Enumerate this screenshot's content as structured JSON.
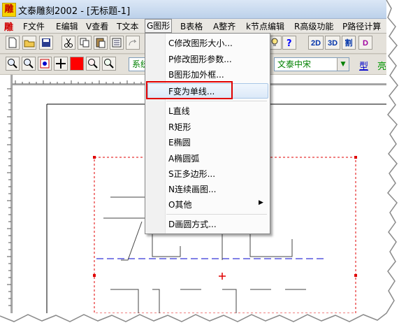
{
  "app": {
    "logo_char": "雕",
    "title": "文泰雕刻2002 - [无标题-1]"
  },
  "menubar": {
    "logo_char": "雕",
    "items": [
      "F文件",
      "E编辑",
      "V查看",
      "T文本",
      "G图形",
      "B表格",
      "A整齐",
      "k节点编辑",
      "R高级功能",
      "P路径计算"
    ],
    "active_index": 4
  },
  "toolbar1": {
    "icons": [
      "new-file",
      "open-folder",
      "save",
      "cut",
      "copy",
      "paste",
      "page-setup",
      "redo"
    ],
    "right_icons": [
      "bulb",
      "help"
    ],
    "buttons": [
      "2D",
      "3D",
      "割",
      "D"
    ]
  },
  "toolbar2": {
    "icons": [
      "zoom-in",
      "zoom-out",
      "zoom-fit",
      "pan",
      "color-red",
      "zoom-area",
      "zoom-page"
    ],
    "combo_left": "系统",
    "font_combo": "文泰中宋",
    "type_link": "型",
    "extra_label": "亮"
  },
  "dropdown": {
    "items": [
      {
        "label": "C修改图形大小..."
      },
      {
        "label": "P修改图形参数..."
      },
      {
        "label": "B图形加外框..."
      },
      {
        "label": "F变为单线..."
      },
      {
        "label": "L直线"
      },
      {
        "label": "R矩形"
      },
      {
        "label": "E椭圆"
      },
      {
        "label": "A椭圆弧"
      },
      {
        "label": "S正多边形..."
      },
      {
        "label": "N连续画图..."
      },
      {
        "label": "O其他",
        "submenu": true
      },
      {
        "label": "D画圆方式..."
      }
    ],
    "highlighted_index": 3
  },
  "canvas_glyphs": "无患",
  "colors": {
    "accent_red": "#e00000",
    "guide_blue": "#0000cc",
    "menu_highlight": "#dbe9f8"
  }
}
